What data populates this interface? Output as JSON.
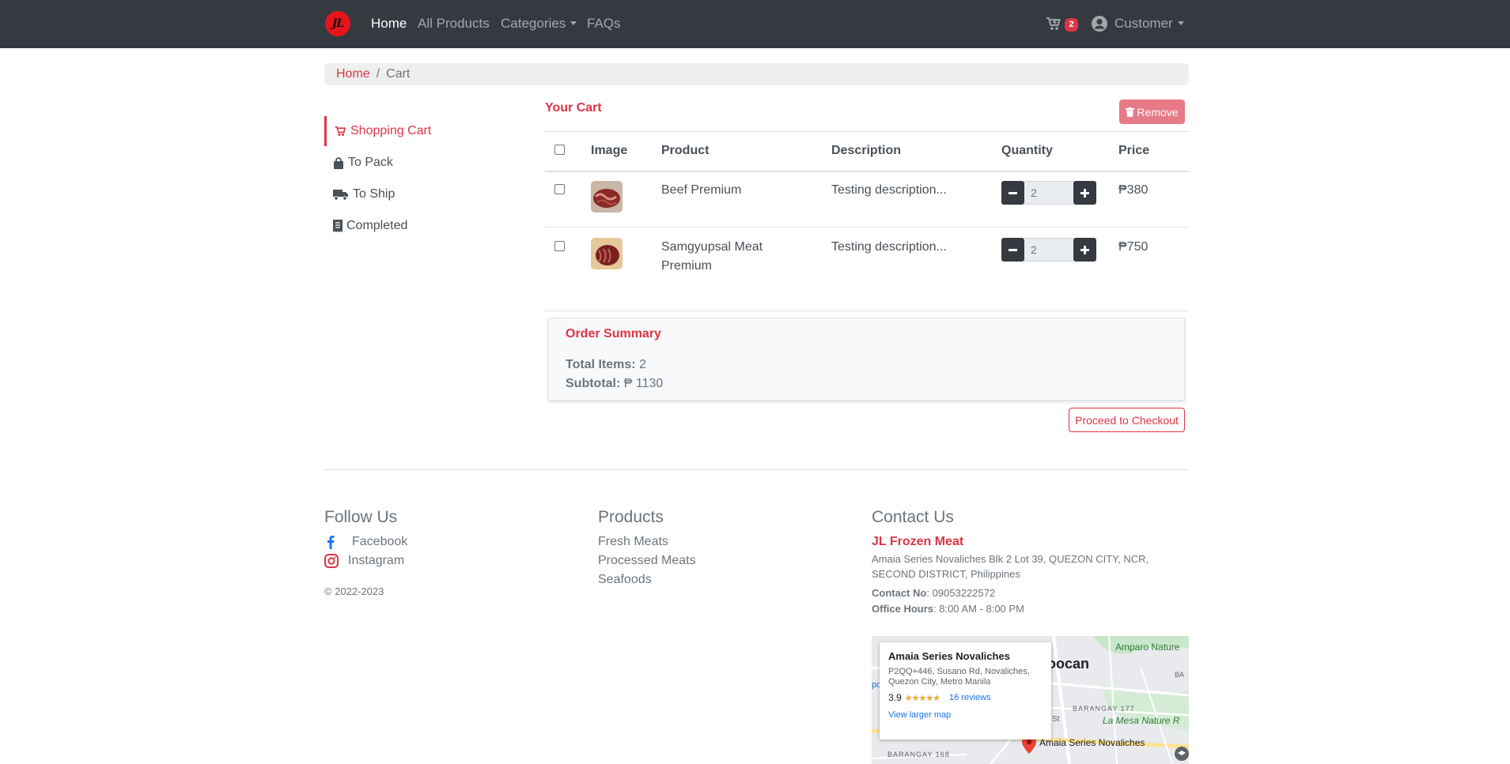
{
  "navbar": {
    "logo_text": "JL",
    "links": [
      "Home",
      "All Products",
      "Categories",
      "FAQs"
    ],
    "cart_count": "2",
    "user_label": "Customer"
  },
  "breadcrumb": {
    "home": "Home",
    "current": "Cart"
  },
  "sidebar": [
    {
      "label": "Shopping Cart",
      "icon": "cart-icon"
    },
    {
      "label": "To Pack",
      "icon": "bag-icon"
    },
    {
      "label": "To Ship",
      "icon": "truck-icon"
    },
    {
      "label": "Completed",
      "icon": "receipt-icon"
    }
  ],
  "cart": {
    "title": "Your Cart",
    "remove_label": "Remove",
    "headers": [
      "Image",
      "Product",
      "Description",
      "Quantity",
      "Price"
    ],
    "rows": [
      {
        "product": "Beef Premium",
        "description": "Testing description...",
        "quantity": "2",
        "price": "₱380"
      },
      {
        "product": "Samgyupsal Meat Premium",
        "description": "Testing description...",
        "quantity": "2",
        "price": "₱750"
      }
    ]
  },
  "summary": {
    "title": "Order Summary",
    "total_items_label": "Total Items:",
    "total_items_value": "2",
    "subtotal_label": "Subtotal:",
    "subtotal_value": "₱ 1130",
    "checkout_label": "Proceed to Checkout"
  },
  "footer": {
    "follow_title": "Follow Us",
    "facebook": "Facebook",
    "instagram": "Instagram",
    "copyright": "© 2022-2023",
    "products_title": "Products",
    "products": [
      "Fresh Meats",
      "Processed Meats",
      "Seafoods"
    ],
    "contact_title": "Contact Us",
    "company": "JL Frozen Meat",
    "address": "Amaia Series Novaliches Blk 2 Lot 39, QUEZON CITY, NCR, SECOND DISTRICT, Philippines",
    "contact_label": "Contact No",
    "contact_value": ": 09053222572",
    "hours_label": "Office Hours",
    "hours_value": ": 8:00 AM - 8:00 PM"
  },
  "map": {
    "place_name": "Amaia Series Novaliches",
    "address": "P2QQ+446, Susano Rd, Novaliches, Quezon City, Metro Manila",
    "rating": "3.9",
    "stars": "★★★★★",
    "reviews": "16 reviews",
    "larger_map": "View larger map",
    "labels": [
      "oocan",
      "Amparo Nature",
      "BARANGAY 177",
      "La Mesa Nature R",
      "St",
      "Amaia Series Novaliches",
      "BARANGAY 168",
      "BA",
      "pc"
    ]
  },
  "colors": {
    "accent": "#dc3545",
    "navbar": "#343a40"
  }
}
